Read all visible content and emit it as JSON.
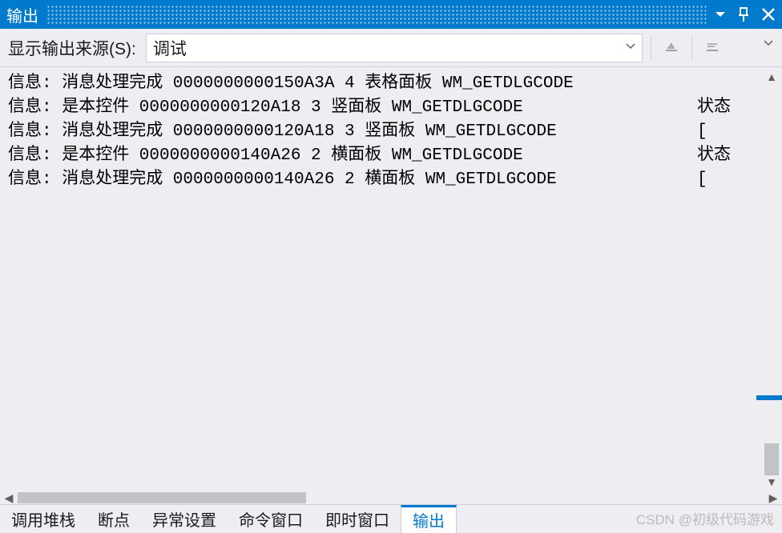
{
  "titlebar": {
    "title": "输出"
  },
  "toolbar": {
    "source_label": "显示输出来源(S):",
    "combo_value": "调试"
  },
  "output_lines": [
    {
      "left": "信息: 消息处理完成 0000000000150A3A 4 表格面板 WM_GETDLGCODE",
      "right": ""
    },
    {
      "left": "信息: 是本控件 0000000000120A18 3 竖面板 WM_GETDLGCODE",
      "right": "状态"
    },
    {
      "left": "信息: 消息处理完成 0000000000120A18 3 竖面板 WM_GETDLGCODE",
      "right": "["
    },
    {
      "left": "信息: 是本控件 0000000000140A26 2 横面板 WM_GETDLGCODE",
      "right": "状态"
    },
    {
      "left": "信息: 消息处理完成 0000000000140A26 2 横面板 WM_GETDLGCODE",
      "right": "["
    }
  ],
  "tabs": [
    {
      "label": "调用堆栈",
      "active": false
    },
    {
      "label": "断点",
      "active": false
    },
    {
      "label": "异常设置",
      "active": false
    },
    {
      "label": "命令窗口",
      "active": false
    },
    {
      "label": "即时窗口",
      "active": false
    },
    {
      "label": "输出",
      "active": true
    }
  ],
  "watermark": "CSDN @初级代码游戏",
  "accent_color": "#007acc"
}
